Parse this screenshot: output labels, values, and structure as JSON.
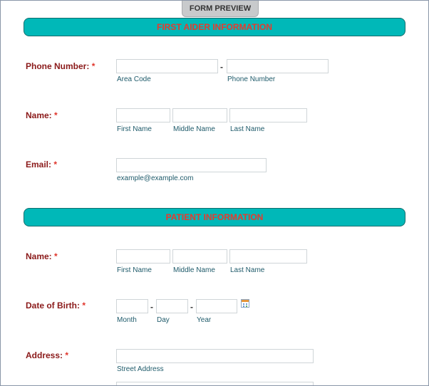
{
  "tab": {
    "label": "FORM PREVIEW"
  },
  "first_aider": {
    "header": "FIRST AIDER INFORMATION",
    "phone": {
      "label": "Phone Number:",
      "required": "*",
      "area_code": "Area Code",
      "number": "Phone Number"
    },
    "name": {
      "label": "Name:",
      "required": "*",
      "first": "First Name",
      "middle": "Middle Name",
      "last": "Last Name"
    },
    "email": {
      "label": "Email:",
      "required": "*",
      "hint": "example@example.com"
    }
  },
  "patient": {
    "header": "PATIENT INFORMATION",
    "name": {
      "label": "Name:",
      "required": "*",
      "first": "First Name",
      "middle": "Middle Name",
      "last": "Last Name"
    },
    "dob": {
      "label": "Date of Birth:",
      "required": "*",
      "month": "Month",
      "day": "Day",
      "year": "Year"
    },
    "address": {
      "label": "Address:",
      "required": "*",
      "street": "Street Address"
    }
  },
  "separators": {
    "dash": "-"
  },
  "icons": {
    "calendar": "calendar-icon"
  },
  "colors": {
    "header_bg": "#00b8b8",
    "header_text": "#e8392d",
    "label": "#8b1a1a",
    "required": "#e0342a",
    "sublabel": "#1e5a6a"
  }
}
